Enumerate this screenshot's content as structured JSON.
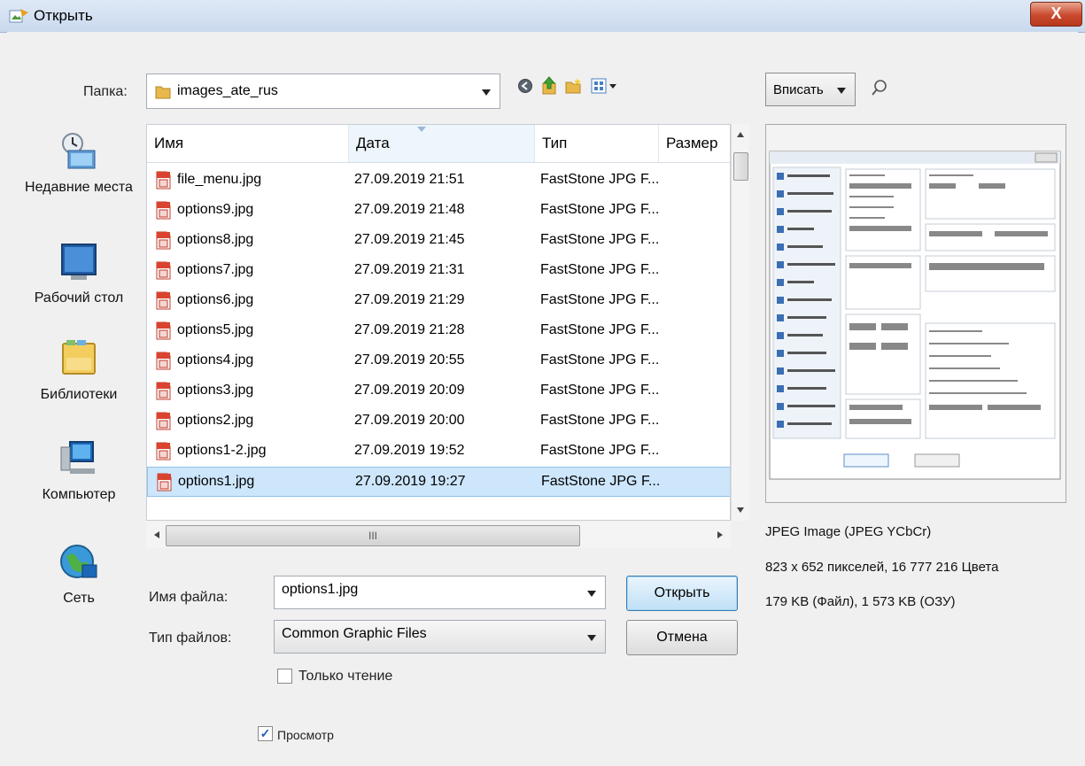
{
  "window": {
    "title": "Открыть",
    "close": "X"
  },
  "folder": {
    "label": "Папка:",
    "value": "images_ate_rus"
  },
  "places": [
    {
      "label": "Недавние места",
      "icon": "recent-places-icon"
    },
    {
      "label": "Рабочий стол",
      "icon": "desktop-icon"
    },
    {
      "label": "Библиотеки",
      "icon": "libraries-icon"
    },
    {
      "label": "Компьютер",
      "icon": "computer-icon"
    },
    {
      "label": "Сеть",
      "icon": "network-icon"
    }
  ],
  "columns": {
    "name": "Имя",
    "date": "Дата",
    "type": "Тип",
    "size": "Размер"
  },
  "files": [
    {
      "name": "file_menu.jpg",
      "date": "27.09.2019 21:51",
      "type": "FastStone JPG F..."
    },
    {
      "name": "options9.jpg",
      "date": "27.09.2019 21:48",
      "type": "FastStone JPG F..."
    },
    {
      "name": "options8.jpg",
      "date": "27.09.2019 21:45",
      "type": "FastStone JPG F..."
    },
    {
      "name": "options7.jpg",
      "date": "27.09.2019 21:31",
      "type": "FastStone JPG F..."
    },
    {
      "name": "options6.jpg",
      "date": "27.09.2019 21:29",
      "type": "FastStone JPG F..."
    },
    {
      "name": "options5.jpg",
      "date": "27.09.2019 21:28",
      "type": "FastStone JPG F..."
    },
    {
      "name": "options4.jpg",
      "date": "27.09.2019 20:55",
      "type": "FastStone JPG F..."
    },
    {
      "name": "options3.jpg",
      "date": "27.09.2019 20:09",
      "type": "FastStone JPG F..."
    },
    {
      "name": "options2.jpg",
      "date": "27.09.2019 20:00",
      "type": "FastStone JPG F..."
    },
    {
      "name": "options1-2.jpg",
      "date": "27.09.2019 19:52",
      "type": "FastStone JPG F..."
    },
    {
      "name": "options1.jpg",
      "date": "27.09.2019 19:27",
      "type": "FastStone JPG F...",
      "selected": true
    }
  ],
  "hscroll_grip": "III",
  "filename": {
    "label": "Имя файла:",
    "value": "options1.jpg"
  },
  "filetype": {
    "label": "Тип файлов:",
    "value": "Common Graphic Files"
  },
  "buttons": {
    "open": "Открыть",
    "cancel": "Отмена"
  },
  "readonly": {
    "label": "Только чтение",
    "checked": false
  },
  "preview_toggle": {
    "label": "Просмотр",
    "checked": true,
    "check_glyph": "✓"
  },
  "fit": {
    "value": "Вписать"
  },
  "image_info": {
    "format": "JPEG Image (JPEG YCbCr)",
    "dimensions": "823 x 652 пикселей, 16 777 216 Цвета",
    "size": "179 KB (Файл), 1 573 KB (ОЗУ)"
  },
  "colors": {
    "selection": "#cde6fb",
    "close": "#c94a2e",
    "folder": "#e8b84a"
  }
}
